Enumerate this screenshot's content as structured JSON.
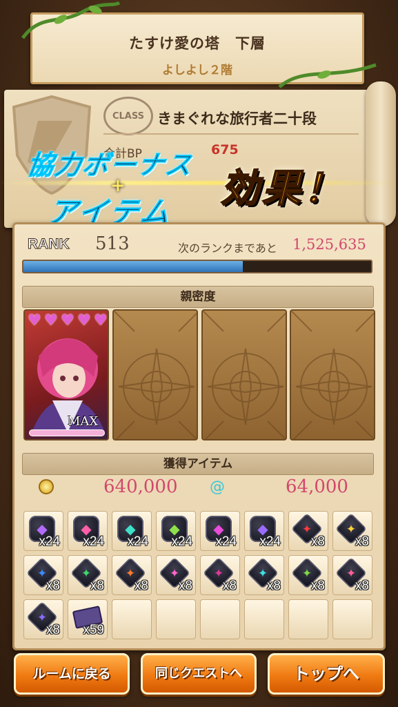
{
  "header": {
    "title": "たすけ愛の塔　下層",
    "subtitle": "よしよし２階"
  },
  "player": {
    "class_stamp": "CLASS",
    "class_name": "きまぐれな旅行者二十段",
    "bp_label": "合計BP",
    "bp_value": "675"
  },
  "bonus": {
    "line1": "協力ボーナス",
    "plus": "+",
    "line2": "アイテム",
    "effect": "効果！"
  },
  "rank": {
    "label": "RANK",
    "value": "513",
    "next_label": "次のランクまであと",
    "next_value": "1,525,635",
    "progress": 0.63
  },
  "affinity": {
    "title": "親密度",
    "hearts": 5,
    "max_label": "MAX"
  },
  "items": {
    "title": "獲得アイテム",
    "coins": "640,000",
    "swirl": "64,000",
    "grid": [
      {
        "icon": "purple-orb-icon",
        "color": "#b36bff",
        "qty": "x24"
      },
      {
        "icon": "pink-orb-icon",
        "color": "#ff5fa8",
        "qty": "x24"
      },
      {
        "icon": "teal-orb-icon",
        "color": "#3fe0c8",
        "qty": "x24"
      },
      {
        "icon": "green-orb-icon",
        "color": "#8ee04a",
        "qty": "x24"
      },
      {
        "icon": "magenta-orb-icon",
        "color": "#e84cd8",
        "qty": "x24"
      },
      {
        "icon": "violet-orb-icon",
        "color": "#9a6bff",
        "qty": "x24"
      },
      {
        "icon": "red-sword-icon",
        "color": "#ff3b3b",
        "qty": "x8"
      },
      {
        "icon": "yellow-glove-icon",
        "color": "#ffd23a",
        "qty": "x8"
      },
      {
        "icon": "blue-spear-icon",
        "color": "#3b8cff",
        "qty": "x8"
      },
      {
        "icon": "green-arrow-icon",
        "color": "#3ed96a",
        "qty": "x8"
      },
      {
        "icon": "orange-bow-icon",
        "color": "#ff7a2a",
        "qty": "x8"
      },
      {
        "icon": "pink-staff-icon",
        "color": "#ff66cc",
        "qty": "x8"
      },
      {
        "icon": "magenta-blade-icon",
        "color": "#e0389a",
        "qty": "x8"
      },
      {
        "icon": "cyan-star-icon",
        "color": "#3ee0e0",
        "qty": "x8"
      },
      {
        "icon": "green-claw-icon",
        "color": "#7ad94a",
        "qty": "x8"
      },
      {
        "icon": "pink-boot-icon",
        "color": "#ff5f9a",
        "qty": "x8"
      },
      {
        "icon": "violet-sword-icon",
        "color": "#8a6bff",
        "qty": "x8"
      },
      {
        "icon": "ticket-icon",
        "color": "#7c66c8",
        "qty": "x59"
      }
    ]
  },
  "buttons": {
    "room": "ルームに戻る",
    "same_quest": "同じクエストへ",
    "top": "トップへ"
  }
}
